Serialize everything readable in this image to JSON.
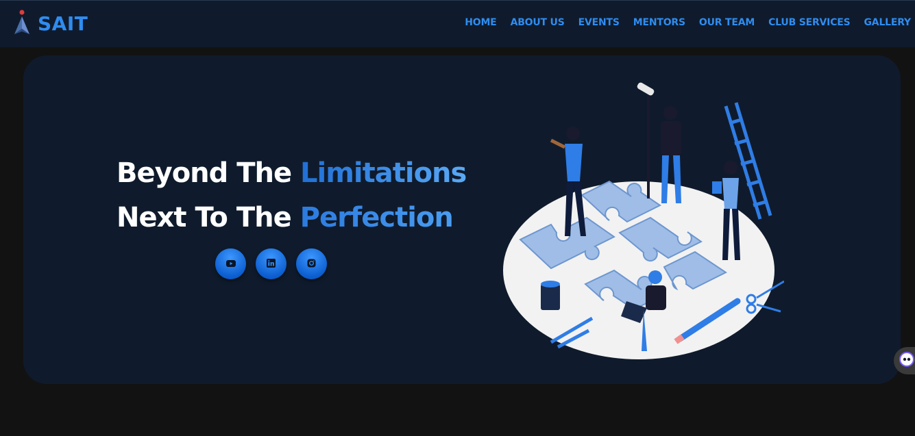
{
  "brand": {
    "name": "SAIT"
  },
  "nav": {
    "items": [
      {
        "label": "HOME"
      },
      {
        "label": "ABOUT US"
      },
      {
        "label": "EVENTS"
      },
      {
        "label": "MENTORS"
      },
      {
        "label": "OUR TEAM"
      },
      {
        "label": "CLUB SERVICES"
      },
      {
        "label": "GALLERY"
      }
    ]
  },
  "hero": {
    "line1_prefix": "Beyond The ",
    "line1_accent": "Limitations",
    "line2_prefix": "Next To The ",
    "line2_accent": "Perfection"
  },
  "socials": [
    {
      "icon": "youtube-icon"
    },
    {
      "icon": "linkedin-icon"
    },
    {
      "icon": "instagram-icon"
    }
  ],
  "colors": {
    "accent": "#2f8cf0",
    "navbar_bg": "#0f1b2c",
    "page_bg": "#121212"
  }
}
